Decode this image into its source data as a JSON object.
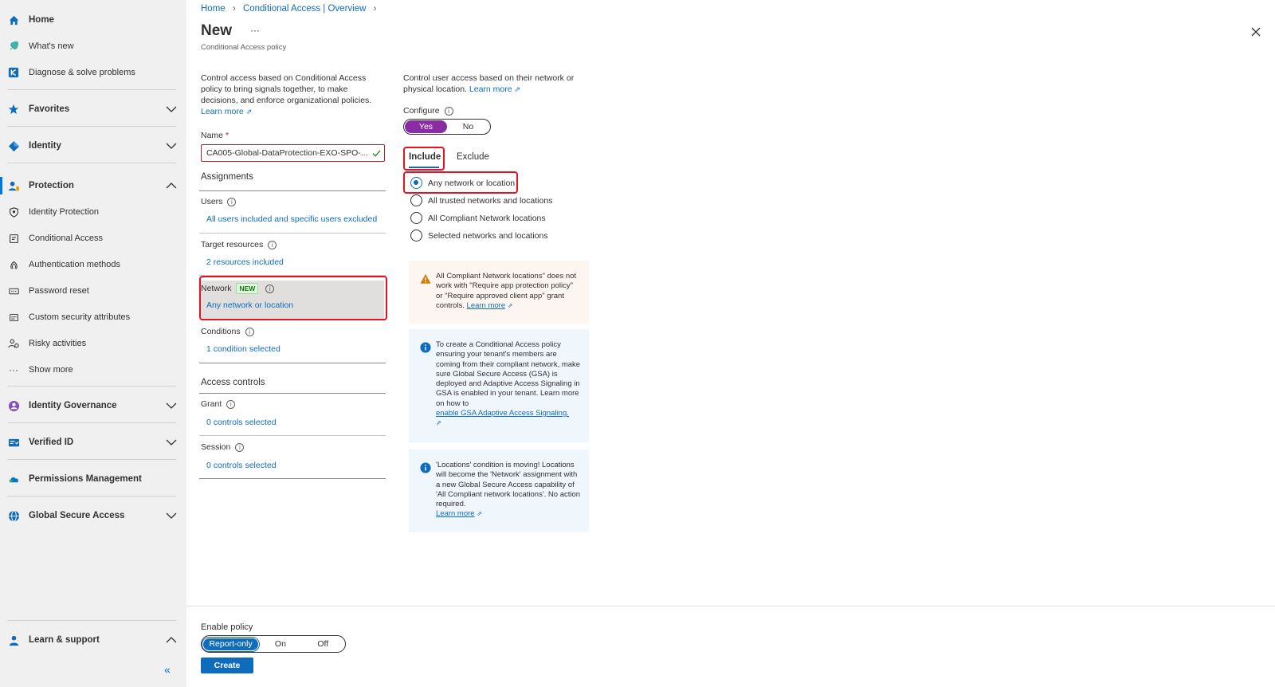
{
  "sidebar": {
    "home": "Home",
    "whats_new": "What's new",
    "diagnose": "Diagnose & solve problems",
    "favorites": "Favorites",
    "identity": "Identity",
    "protection": "Protection",
    "protection_items": [
      "Identity Protection",
      "Conditional Access",
      "Authentication methods",
      "Password reset",
      "Custom security attributes",
      "Risky activities",
      "Show more"
    ],
    "identity_governance": "Identity Governance",
    "verified_id": "Verified ID",
    "permissions_management": "Permissions Management",
    "global_secure_access": "Global Secure Access",
    "learn_support": "Learn & support",
    "collapse_glyph": "«"
  },
  "breadcrumb": {
    "home": "Home",
    "overview": "Conditional Access | Overview"
  },
  "page": {
    "title": "New",
    "more": "···",
    "subtitle": "Conditional Access policy"
  },
  "left_col": {
    "intro": "Control access based on Conditional Access policy to bring signals together, to make decisions, and enforce organizational policies.",
    "learn_more": "Learn more",
    "name_label": "Name",
    "name_required": "*",
    "name_value": "CA005-Global-DataProtection-EXO-SPO-...",
    "assignments": "Assignments",
    "users_label": "Users",
    "users_value": "All users included and specific users excluded",
    "target_label": "Target resources",
    "target_value": "2 resources included",
    "network_label": "Network",
    "network_badge": "NEW",
    "network_value": "Any network or location",
    "conditions_label": "Conditions",
    "conditions_value": "1 condition selected",
    "access_controls": "Access controls",
    "grant_label": "Grant",
    "grant_value": "0 controls selected",
    "session_label": "Session",
    "session_value": "0 controls selected"
  },
  "right_col": {
    "intro": "Control user access based on their network or physical location.",
    "learn_more": "Learn more",
    "configure_label": "Configure",
    "configure_yes": "Yes",
    "configure_no": "No",
    "tab_include": "Include",
    "tab_exclude": "Exclude",
    "options": [
      "Any network or location",
      "All trusted networks and locations",
      "All Compliant Network locations",
      "Selected networks and locations"
    ],
    "selected_option": 0,
    "warning_text": "All Compliant Network locations\" does not work with \"Require app protection policy\" or \"Require approved client app\" grant controls.",
    "warning_link": "Learn more",
    "info1_text": "To create a Conditional Access policy ensuring your tenant's members are coming from their compliant network, make sure Global Secure Access (GSA) is deployed and Adaptive Access Signaling in GSA is enabled in your tenant. Learn more on how to",
    "info1_link": "enable GSA Adaptive Access Signaling.",
    "info2_text": "'Locations' condition is moving! Locations will become the 'Network' assignment with a new Global Secure Access capability of 'All Compliant network locations'. No action required.",
    "info2_link": "Learn more"
  },
  "footer": {
    "enable_label": "Enable policy",
    "opt_report": "Report-only",
    "opt_on": "On",
    "opt_off": "Off",
    "create": "Create"
  },
  "colors": {
    "accent": "#0f6cbd",
    "toggle_selected": "#8a2da5",
    "highlight": "#e81123",
    "warning_bg": "#fdf6f0",
    "info_bg": "#eff6fc"
  }
}
